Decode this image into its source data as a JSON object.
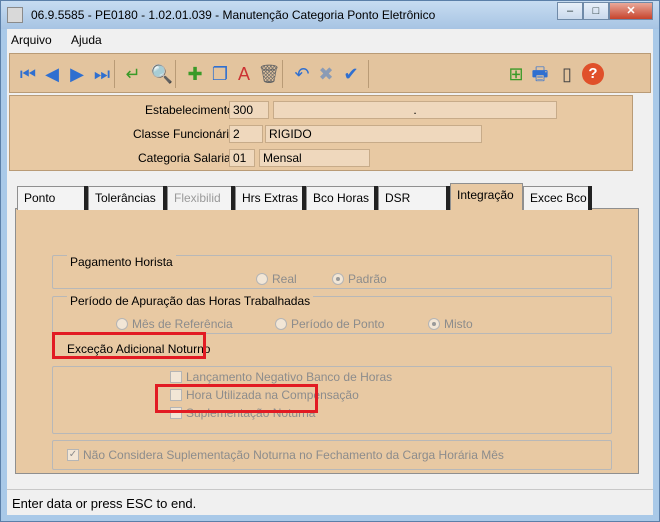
{
  "window": {
    "title": "06.9.5585 - PE0180 - 1.02.01.039 - Manutenção Categoria Ponto Eletrônico",
    "minimize": "–",
    "maximize": "□",
    "close": "✕"
  },
  "menu": {
    "items": [
      {
        "label": "Arquivo",
        "underline": "A"
      },
      {
        "label": "Ajuda",
        "underline": "j"
      }
    ]
  },
  "toolbar": {
    "buttons": [
      {
        "name": "first-record-button",
        "icon": "first-icon",
        "glyph": "⏮",
        "color": "#2f6fd0"
      },
      {
        "name": "previous-record-button",
        "icon": "previous-icon",
        "glyph": "◀",
        "color": "#2f6fd0"
      },
      {
        "name": "next-record-button",
        "icon": "next-icon",
        "glyph": "▶",
        "color": "#2f6fd0"
      },
      {
        "name": "last-record-button",
        "icon": "last-icon",
        "glyph": "⏭",
        "color": "#2f6fd0"
      },
      {
        "name": "goto-button",
        "icon": "return-arrow-icon",
        "glyph": "↵",
        "color": "#3a9a28"
      },
      {
        "name": "search-button",
        "icon": "zoom-icon",
        "glyph": "🔍",
        "color": "#666"
      },
      {
        "name": "add-button",
        "icon": "new-document-icon",
        "glyph": "✚",
        "color": "#3a9a28"
      },
      {
        "name": "copy-button",
        "icon": "copy-icon",
        "glyph": "❐",
        "color": "#2f6fd0"
      },
      {
        "name": "edit-button",
        "icon": "edit-text-icon",
        "glyph": "A",
        "color": "#c33"
      },
      {
        "name": "delete-button",
        "icon": "trash-icon",
        "glyph": "🗑",
        "color": "#666"
      },
      {
        "name": "undo-button",
        "icon": "undo-icon",
        "glyph": "↶",
        "color": "#2f6fd0"
      },
      {
        "name": "cancel-button",
        "icon": "cancel-x-icon",
        "glyph": "✖",
        "color": "#8a9bb5"
      },
      {
        "name": "confirm-button",
        "icon": "check-icon",
        "glyph": "✔",
        "color": "#2f6fd0"
      },
      {
        "name": "structure-button",
        "icon": "tree-icon",
        "glyph": "⊞",
        "color": "#3a9a28"
      },
      {
        "name": "print-button",
        "icon": "printer-icon",
        "glyph": "🖶",
        "color": "#2f6fd0"
      },
      {
        "name": "exit-button",
        "icon": "door-exit-icon",
        "glyph": "▯",
        "color": "#444"
      },
      {
        "name": "help-button",
        "icon": "help-icon",
        "glyph": "?",
        "color": "#e0502a"
      }
    ]
  },
  "header": {
    "estabelecimento": {
      "label": "Estabelecimento:",
      "code": "300",
      "desc": "."
    },
    "classe": {
      "label": "Classe Funcionário:",
      "code": "2",
      "desc": "RIGIDO"
    },
    "categoria": {
      "label": "Categoria Salarial:",
      "code": "01",
      "desc": "Mensal"
    }
  },
  "tabs": [
    {
      "label": "Ponto",
      "state": "normal"
    },
    {
      "label": "Tolerâncias",
      "state": "normal"
    },
    {
      "label": "Flexibilid",
      "state": "disabled"
    },
    {
      "label": "Hrs Extras",
      "state": "normal"
    },
    {
      "label": "Bco Horas",
      "state": "normal"
    },
    {
      "label": "DSR",
      "state": "normal"
    },
    {
      "label": "Integração",
      "state": "active"
    },
    {
      "label": "Excec Bco",
      "state": "normal"
    }
  ],
  "integracao": {
    "pagamento": {
      "title": "Pagamento Horista",
      "options": [
        {
          "label": "Real",
          "selected": false
        },
        {
          "label": "Padrão",
          "selected": true
        }
      ]
    },
    "periodo": {
      "title": "Período de Apuração das Horas Trabalhadas",
      "options": [
        {
          "label": "Mês de Referência",
          "selected": false
        },
        {
          "label": "Período de Ponto",
          "selected": false
        },
        {
          "label": "Misto",
          "selected": true
        }
      ]
    },
    "excecao": {
      "title": "Exceção Adicional Noturno",
      "checks": [
        {
          "label": "Lançamento Negativo Banco de Horas",
          "checked": false
        },
        {
          "label": "Hora Utilizada na Compensação",
          "checked": false
        },
        {
          "label": "Suplementação Noturna",
          "checked": false
        }
      ]
    },
    "nao_considera": {
      "label": "Não Considera Suplementação Noturna no Fechamento da Carga Horária Mês",
      "checked": true
    }
  },
  "status": {
    "text": "Enter data or press ESC to end."
  },
  "colors": {
    "panel": "#e8c9a3",
    "highlight": "#e21b23",
    "disabled_text": "#8c8c8c"
  }
}
